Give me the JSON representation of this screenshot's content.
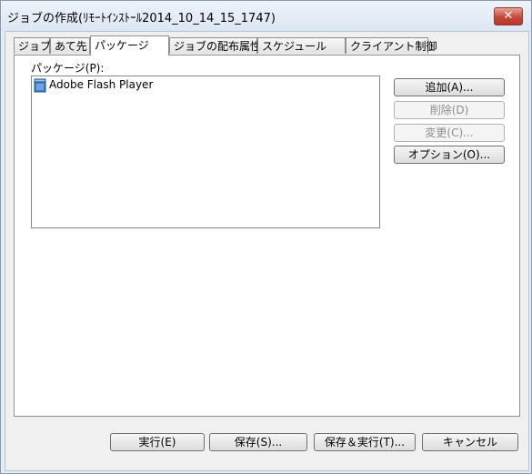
{
  "window": {
    "title": "ジョブの作成(ﾘﾓｰﾄｲﾝｽﾄｰﾙ2014_10_14_15_1747)",
    "close_glyph": "✕"
  },
  "tabs": [
    {
      "label": "ジョブ"
    },
    {
      "label": "あて先"
    },
    {
      "label": "パッケージ"
    },
    {
      "label": "ジョブの配布属性"
    },
    {
      "label": "スケジュール"
    },
    {
      "label": "クライアント制御"
    }
  ],
  "packages": {
    "label": "パッケージ(P):",
    "items": [
      "Adobe Flash Player"
    ],
    "item_icon": "package-icon"
  },
  "side_buttons": {
    "add": "追加(A)...",
    "delete": "削除(D)",
    "change": "変更(C)...",
    "options": "オプション(O)..."
  },
  "bottom_buttons": {
    "execute": "実行(E)",
    "save": "保存(S)...",
    "save_execute": "保存＆実行(T)...",
    "cancel": "キャンセル"
  },
  "colors": {
    "accent_close": "#c7483a",
    "window_frame": "#dce6f2"
  }
}
